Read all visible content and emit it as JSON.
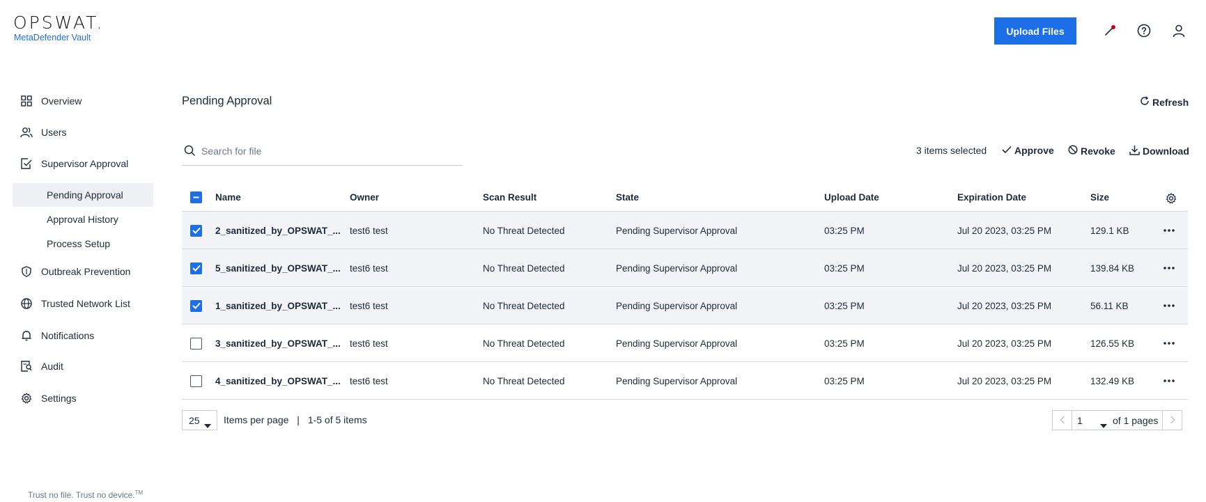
{
  "header": {
    "brand": "OPSWAT.",
    "product": "MetaDefender Vault",
    "upload_label": "Upload Files",
    "colors": {
      "accent": "#1d6fe8",
      "notification_dot": "#d0021b"
    },
    "icons": [
      "integration-icon",
      "help-icon",
      "user-icon"
    ]
  },
  "sidebar": {
    "items": [
      {
        "label": "Overview",
        "icon": "grid-icon"
      },
      {
        "label": "Users",
        "icon": "users-icon"
      },
      {
        "label": "Supervisor Approval",
        "icon": "checklist-icon"
      },
      {
        "label": "Outbreak Prevention",
        "icon": "shield-icon"
      },
      {
        "label": "Trusted Network List",
        "icon": "globe-icon"
      },
      {
        "label": "Notifications",
        "icon": "bell-icon"
      },
      {
        "label": "Audit",
        "icon": "audit-icon"
      },
      {
        "label": "Settings",
        "icon": "gear-icon"
      }
    ],
    "subitems": [
      {
        "label": "Pending Approval",
        "active": true
      },
      {
        "label": "Approval History",
        "active": false
      },
      {
        "label": "Process Setup",
        "active": false
      }
    ],
    "tagline": "Trust no file. Trust no device.",
    "tagline_mark": "TM"
  },
  "main": {
    "title": "Pending Approval",
    "refresh_label": "Refresh",
    "search_placeholder": "Search for file",
    "selected_text": "3 items selected",
    "actions": {
      "approve": "Approve",
      "revoke": "Revoke",
      "download": "Download"
    }
  },
  "table": {
    "columns": [
      "Name",
      "Owner",
      "Scan Result",
      "State",
      "Upload Date",
      "Expiration Date",
      "Size"
    ],
    "rows": [
      {
        "selected": true,
        "name": "2_sanitized_by_OPSWAT_...",
        "owner": "test6 test",
        "scan": "No Threat Detected",
        "state": "Pending Supervisor Approval",
        "upload": "03:25 PM",
        "expiration": "Jul 20 2023, 03:25 PM",
        "size": "129.1 KB"
      },
      {
        "selected": true,
        "name": "5_sanitized_by_OPSWAT_...",
        "owner": "test6 test",
        "scan": "No Threat Detected",
        "state": "Pending Supervisor Approval",
        "upload": "03:25 PM",
        "expiration": "Jul 20 2023, 03:25 PM",
        "size": "139.84 KB"
      },
      {
        "selected": true,
        "name": "1_sanitized_by_OPSWAT_...",
        "owner": "test6 test",
        "scan": "No Threat Detected",
        "state": "Pending Supervisor Approval",
        "upload": "03:25 PM",
        "expiration": "Jul 20 2023, 03:25 PM",
        "size": "56.11 KB"
      },
      {
        "selected": false,
        "name": "3_sanitized_by_OPSWAT_...",
        "owner": "test6 test",
        "scan": "No Threat Detected",
        "state": "Pending Supervisor Approval",
        "upload": "03:25 PM",
        "expiration": "Jul 20 2023, 03:25 PM",
        "size": "126.55 KB"
      },
      {
        "selected": false,
        "name": "4_sanitized_by_OPSWAT_...",
        "owner": "test6 test",
        "scan": "No Threat Detected",
        "state": "Pending Supervisor Approval",
        "upload": "03:25 PM",
        "expiration": "Jul 20 2023, 03:25 PM",
        "size": "132.49 KB"
      }
    ]
  },
  "pagination": {
    "per_page": "25",
    "per_page_label": "Items per page",
    "separator": "|",
    "range": "1-5 of 5 items",
    "current_page": "1",
    "of_pages": "of 1 pages"
  }
}
